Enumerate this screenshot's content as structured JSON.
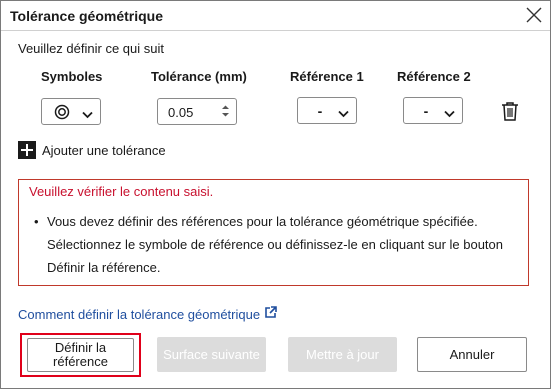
{
  "dialog": {
    "title": "Tolérance géométrique",
    "prompt": "Veuillez définir ce qui suit"
  },
  "columns": {
    "symbols": "Symboles",
    "tolerance": "Tolérance (mm)",
    "ref1": "Référence 1",
    "ref2": "Référence 2"
  },
  "row": {
    "symbol_icon": "concentricity-icon",
    "tolerance_value": "0.05",
    "ref1_value": "-",
    "ref2_value": "-"
  },
  "add_tolerance": {
    "label": "Ajouter une tolérance"
  },
  "error": {
    "title": "Veuillez vérifier le contenu saisi.",
    "messages": [
      "Vous devez définir des références pour la tolérance géométrique spécifiée. Sélectionnez le symbole de référence ou définissez-le en cliquant sur le bouton Définir la référence."
    ],
    "color": "#c8102e"
  },
  "help": {
    "link_text": "Comment définir la tolérance géométrique"
  },
  "buttons": {
    "define_reference": "Définir la référence",
    "next_surface": "Surface suivante",
    "update": "Mettre à jour",
    "cancel": "Annuler"
  },
  "colors": {
    "link": "#1f4e9e",
    "highlight": "#e0001a",
    "disabled_button": "#dcdcdc"
  }
}
